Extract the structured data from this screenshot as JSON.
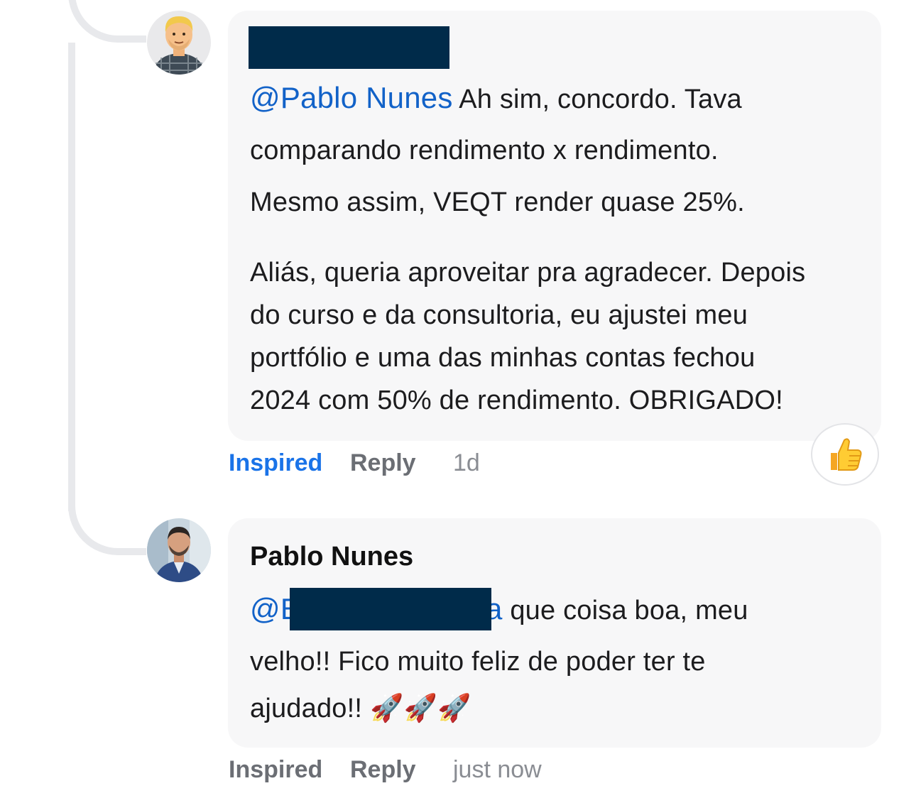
{
  "comments": [
    {
      "author_redacted": true,
      "mention": "@Pablo Nunes",
      "lines": [
        "Ah sim, concordo. Tava",
        "comparando rendimento x rendimento.",
        "Mesmo assim, VEQT render quase 25%."
      ],
      "paragraph2": [
        "Aliás, queria aproveitar pra agradecer. Depois",
        "do curso e da consultoria, eu ajustei meu",
        "portfólio e uma das minhas contas fechou",
        "2024 com 50% de rendimento. OBRIGADO!"
      ],
      "actions": {
        "inspired": "Inspired",
        "reply": "Reply"
      },
      "time": "1d",
      "reaction_icon": "thumbs-up-icon"
    },
    {
      "author": "Pablo Nunes",
      "mention_visible_start": "@B",
      "mention_visible_end": "a",
      "lines": [
        "que coisa boa, meu",
        "velho!! Fico muito feliz de poder ter te",
        "ajudado!!"
      ],
      "emoji": "🚀🚀🚀",
      "actions": {
        "inspired": "Inspired",
        "reply": "Reply"
      },
      "time": "just now"
    }
  ],
  "colors": {
    "accent": "#1a73e8",
    "mention": "#1262c8",
    "redaction": "#002b4a",
    "bubble": "#f7f7f8"
  }
}
